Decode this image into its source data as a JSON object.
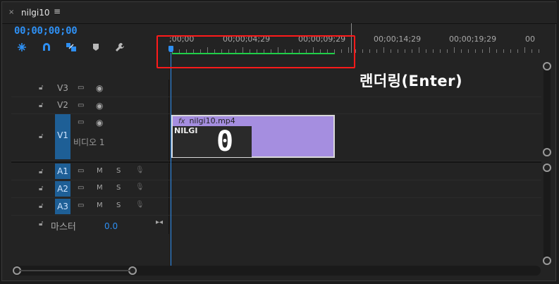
{
  "tab": {
    "close": "×",
    "title": "nilgi10",
    "menu": "≡"
  },
  "timecode": "00;00;00;00",
  "toolbar": {
    "tools": [
      "snap-icon",
      "magnet-icon",
      "linked-selection-icon",
      "marker-icon",
      "wrench-icon"
    ]
  },
  "ruler": {
    "labels": [
      ";00;00",
      "00;00;04;29",
      "00;00;09;29",
      "00;00;14;29",
      "00;00;19;29",
      "00"
    ]
  },
  "annotation": "랜더링(Enter)",
  "tracks": {
    "video": [
      {
        "name": "V3",
        "label": ""
      },
      {
        "name": "V2",
        "label": ""
      },
      {
        "name": "V1",
        "label": "비디오 1"
      }
    ],
    "audio": [
      {
        "name": "A1",
        "m": "M",
        "s": "S"
      },
      {
        "name": "A2",
        "m": "M",
        "s": "S"
      },
      {
        "name": "A3",
        "m": "M",
        "s": "S"
      }
    ],
    "master": {
      "label": "마스터",
      "value": "0.0"
    }
  },
  "clip": {
    "fx": "fx",
    "name": "nilgi10.mp4",
    "thumb_text": "NILGI",
    "thumb_number": "0"
  },
  "colors": {
    "accent": "#2e8ff2",
    "clip": "#a58ee0",
    "work_area": "#1fcf48",
    "highlight": "#ff1a1a"
  }
}
